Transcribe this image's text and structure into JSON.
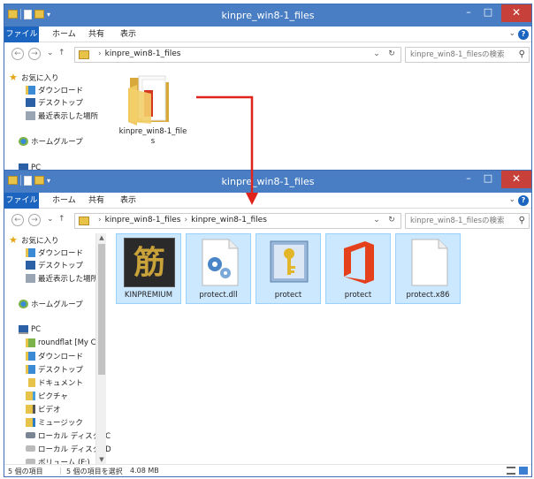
{
  "window_top": {
    "title": "kinpre_win8-1_files",
    "tabs": [
      "ファイル",
      "ホーム",
      "共有",
      "表示"
    ],
    "address": [
      "kinpre_win8-1_files"
    ],
    "search_placeholder": "kinpre_win8-1_filesの検索",
    "nav": {
      "favorites": "お気に入り",
      "downloads": "ダウンロード",
      "desktop": "デスクトップ",
      "recent": "最近表示した場所",
      "homegroup": "ホームグループ",
      "pc": "PC"
    },
    "folder_label": "kinpre_win8-1_files"
  },
  "window_bottom": {
    "title": "kinpre_win8-1_files",
    "tabs": [
      "ファイル",
      "ホーム",
      "共有",
      "表示"
    ],
    "address": [
      "kinpre_win8-1_files",
      "kinpre_win8-1_files"
    ],
    "search_placeholder": "kinpre_win8-1_filesの検索",
    "nav": {
      "favorites": "お気に入り",
      "downloads": "ダウンロード",
      "desktop": "デスクトップ",
      "recent": "最近表示した場所",
      "homegroup": "ホームグループ",
      "pc": "PC",
      "roundflat": "roundflat [My C",
      "pc_downloads": "ダウンロード",
      "pc_desktop": "デスクトップ",
      "documents": "ドキュメント",
      "pictures": "ピクチャ",
      "videos": "ビデオ",
      "music": "ミュージック",
      "local_c": "ローカル ディスク (C",
      "local_d": "ローカル ディスク (D",
      "volume_f": "ボリューム (F:)"
    },
    "files": [
      {
        "name": "KINPREMIUM",
        "icon": "kanji-icon",
        "glyph": "筋"
      },
      {
        "name": "protect.dll",
        "icon": "dll-gear-icon"
      },
      {
        "name": "protect",
        "icon": "key-config-icon"
      },
      {
        "name": "protect",
        "icon": "office-logo-icon"
      },
      {
        "name": "protect.x86",
        "icon": "blank-file-icon"
      }
    ],
    "status": {
      "count": "5 個の項目",
      "selected": "5 個の項目を選択",
      "size": "4.08 MB"
    }
  },
  "colors": {
    "titlebar": "#4a7ec4",
    "file_tab": "#1b65c0",
    "close": "#c7413a",
    "selection": "#cce8ff",
    "arrow": "#e0241b"
  }
}
